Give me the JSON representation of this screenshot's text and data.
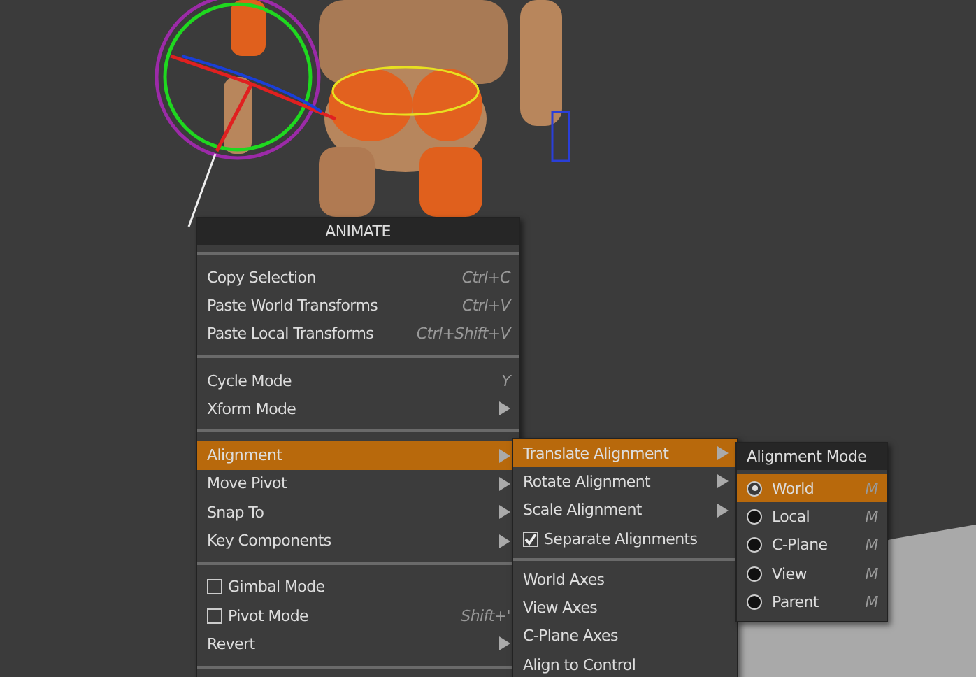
{
  "menu": {
    "title": "ANIMATE",
    "groups": [
      [
        {
          "label": "Copy Selection",
          "shortcut": "Ctrl+C",
          "kind": "plain",
          "selected": false
        },
        {
          "label": "Paste World Transforms",
          "shortcut": "Ctrl+V",
          "kind": "plain",
          "selected": false
        },
        {
          "label": "Paste Local Transforms",
          "shortcut": "Ctrl+Shift+V",
          "kind": "plain",
          "selected": false
        }
      ],
      [
        {
          "label": "Cycle Mode",
          "shortcut": "Y",
          "kind": "plain",
          "selected": false
        },
        {
          "label": "Xform Mode",
          "kind": "submenu",
          "selected": false
        }
      ],
      [
        {
          "label": "Alignment",
          "kind": "submenu",
          "selected": true
        },
        {
          "label": "Move Pivot",
          "kind": "submenu",
          "selected": false
        },
        {
          "label": "Snap To",
          "kind": "submenu",
          "selected": false
        },
        {
          "label": "Key Components",
          "kind": "submenu",
          "selected": false
        }
      ],
      [
        {
          "label": "Gimbal Mode",
          "kind": "check",
          "checked": false,
          "selected": false
        },
        {
          "label": "Pivot Mode",
          "shortcut": "Shift+'",
          "kind": "check",
          "checked": false,
          "selected": false
        },
        {
          "label": "Revert",
          "kind": "submenu",
          "selected": false
        }
      ]
    ]
  },
  "submenu": {
    "groups": [
      [
        {
          "label": "Translate Alignment",
          "kind": "submenu",
          "selected": true
        },
        {
          "label": "Rotate Alignment",
          "kind": "submenu",
          "selected": false
        },
        {
          "label": "Scale Alignment",
          "kind": "submenu",
          "selected": false
        },
        {
          "label": "Separate Alignments",
          "kind": "check",
          "checked": true,
          "selected": false
        }
      ],
      [
        {
          "label": "World Axes",
          "kind": "plain",
          "selected": false
        },
        {
          "label": "View Axes",
          "kind": "plain",
          "selected": false
        },
        {
          "label": "C-Plane Axes",
          "kind": "plain",
          "selected": false
        },
        {
          "label": "Align to Control",
          "kind": "plain",
          "selected": false
        }
      ]
    ]
  },
  "mode_menu": {
    "title": "Alignment Mode",
    "items": [
      {
        "label": "World",
        "shortcut": "M",
        "selected": true
      },
      {
        "label": "Local",
        "shortcut": "M",
        "selected": false
      },
      {
        "label": "C-Plane",
        "shortcut": "M",
        "selected": false
      },
      {
        "label": "View",
        "shortcut": "M",
        "selected": false
      },
      {
        "label": "Parent",
        "shortcut": "M",
        "selected": false
      }
    ]
  }
}
